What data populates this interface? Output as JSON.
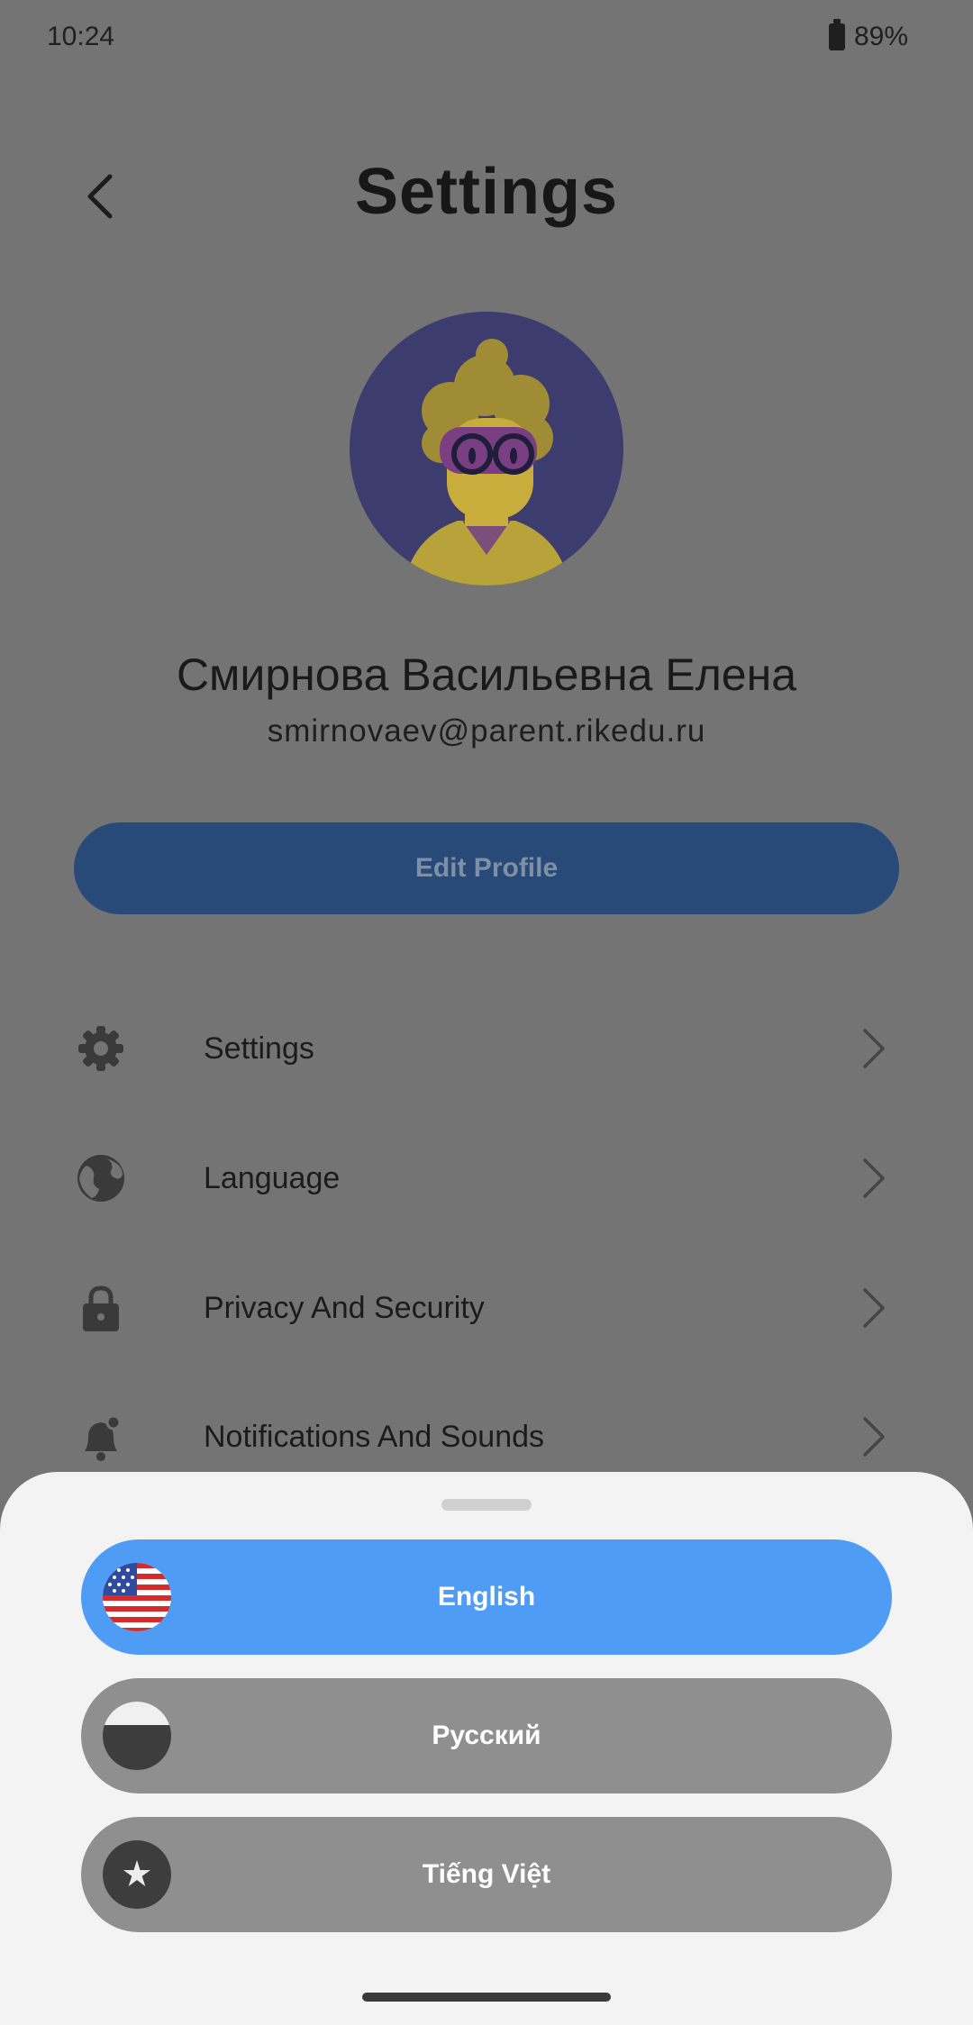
{
  "status_bar": {
    "time": "10:24",
    "battery": "89%"
  },
  "header": {
    "title": "Settings"
  },
  "profile": {
    "name": "Смирнова Васильевна Елена",
    "email": "smirnovaev@parent.rikedu.ru",
    "edit_button": "Edit Profile"
  },
  "menu": {
    "items": [
      {
        "label": "Settings",
        "icon": "gear-icon"
      },
      {
        "label": "Language",
        "icon": "globe-icon"
      },
      {
        "label": "Privacy And Security",
        "icon": "lock-icon"
      },
      {
        "label": "Notifications And Sounds",
        "icon": "bell-icon"
      }
    ]
  },
  "language_sheet": {
    "options": [
      {
        "label": "English",
        "selected": true,
        "flag": "us-flag-icon"
      },
      {
        "label": "Русский",
        "selected": false,
        "flag": "ru-flag-icon"
      },
      {
        "label": "Tiếng Việt",
        "selected": false,
        "flag": "vn-flag-icon"
      }
    ]
  },
  "colors": {
    "overlay_background": "#747474",
    "edit_button": "#284a78",
    "selected_language": "#4f9cf5",
    "unselected_language": "#8f8f8f",
    "sheet_background": "#f3f3f3"
  }
}
